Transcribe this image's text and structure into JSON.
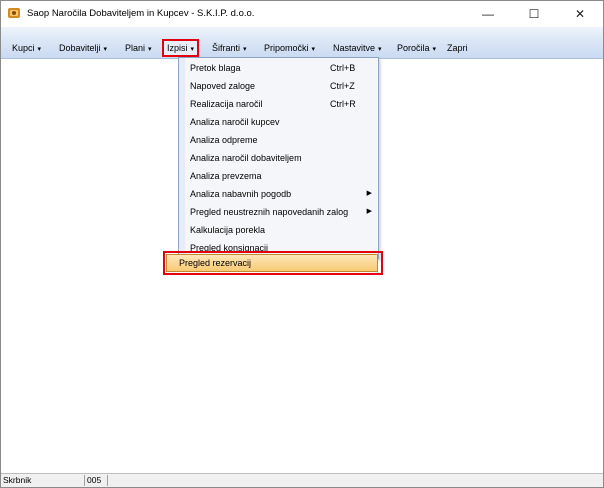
{
  "window": {
    "title": "Saop Naročila Dobaviteljem in Kupcev - S.K.I.P.  d.o.o.",
    "controls": {
      "minimize": "—",
      "maximize": "☐",
      "close": "✕"
    }
  },
  "menubar": {
    "items": [
      {
        "label": "Kupci",
        "arrow": "▾"
      },
      {
        "label": "Dobavitelji",
        "arrow": "▾"
      },
      {
        "label": "Plani",
        "arrow": "▾"
      },
      {
        "label": "Izpisi",
        "arrow": "▾"
      },
      {
        "label": "Šifranti",
        "arrow": "▾"
      },
      {
        "label": "Pripomočki",
        "arrow": "▾"
      },
      {
        "label": "Nastavitve",
        "arrow": "▾"
      },
      {
        "label": "Poročila",
        "arrow": "▾"
      },
      {
        "label": "Zapri",
        "arrow": ""
      }
    ]
  },
  "dropdown": {
    "items": [
      {
        "label": "Pretok blaga",
        "shortcut": "Ctrl+B",
        "submenu": ""
      },
      {
        "label": "Napoved zaloge",
        "shortcut": "Ctrl+Z",
        "submenu": ""
      },
      {
        "label": "Realizacija naročil",
        "shortcut": "Ctrl+R",
        "submenu": ""
      },
      {
        "label": "Analiza naročil kupcev",
        "shortcut": "",
        "submenu": ""
      },
      {
        "label": "Analiza odpreme",
        "shortcut": "",
        "submenu": ""
      },
      {
        "label": "Analiza naročil dobaviteljem",
        "shortcut": "",
        "submenu": ""
      },
      {
        "label": "Analiza prevzema",
        "shortcut": "",
        "submenu": ""
      },
      {
        "label": "Analiza nabavnih pogodb",
        "shortcut": "",
        "submenu": "▶"
      },
      {
        "label": "Pregled neustreznih napovedanih zalog",
        "shortcut": "",
        "submenu": "▶"
      },
      {
        "label": "Kalkulacija porekla",
        "shortcut": "",
        "submenu": ""
      },
      {
        "label": "Pregled konsignacij",
        "shortcut": "",
        "submenu": ""
      }
    ],
    "highlighted": {
      "label": "Pregled rezervacij"
    }
  },
  "statusbar": {
    "user": "Skrbnik",
    "code": "005"
  },
  "colors": {
    "menubar": "#c9daf1",
    "highlight": "#f8c975",
    "annotation": "#e3000f"
  }
}
